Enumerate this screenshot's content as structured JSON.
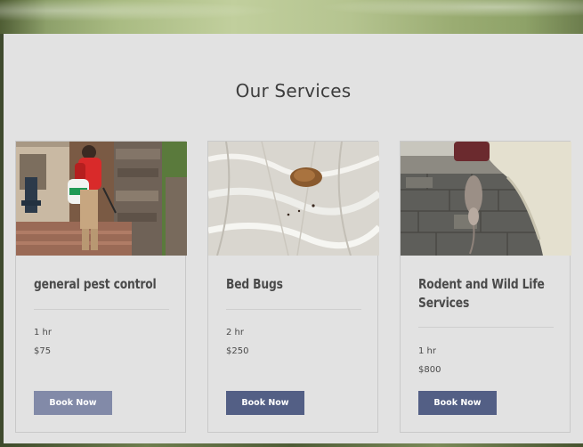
{
  "section": {
    "title": "Our Services"
  },
  "services": [
    {
      "name": "general pest control",
      "duration": "1 hr",
      "price": "$75",
      "button": "Book Now"
    },
    {
      "name": "Bed Bugs",
      "duration": "2 hr",
      "price": "$250",
      "button": "Book Now"
    },
    {
      "name": "Rodent and Wild Life Services",
      "duration": "1 hr",
      "price": "$800",
      "button": "Book Now"
    }
  ],
  "colors": {
    "panel_bg": "#e2e2e2",
    "title_text": "#3d3d3d",
    "button_primary": "#535f85",
    "button_faded": "#828aa8",
    "button_text": "#ffffff"
  },
  "images": [
    "technician-spraying-porch-photo",
    "bed-bug-on-fabric-photo",
    "rodent-held-by-gloved-hand-photo"
  ]
}
